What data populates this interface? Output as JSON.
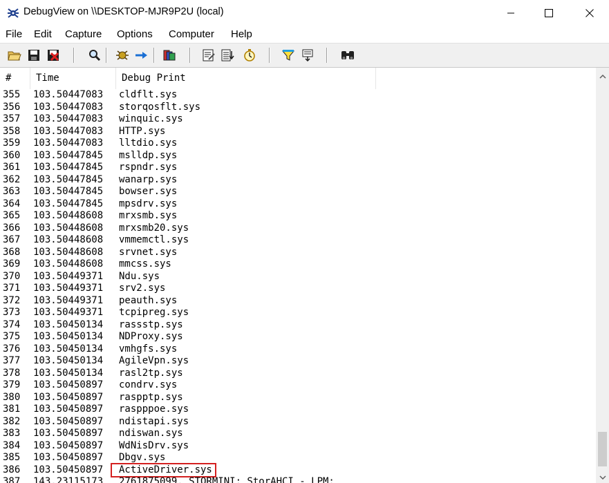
{
  "window": {
    "title": "DebugView on \\\\DESKTOP-MJR9P2U (local)"
  },
  "menu": {
    "items": [
      "File",
      "Edit",
      "Capture",
      "Options",
      "Computer",
      "Help"
    ]
  },
  "toolbar": {
    "icons": [
      "open-icon",
      "save-icon",
      "clear-display-icon",
      "find-icon",
      "capture-icon",
      "autoscroll-icon",
      "history-depth-icon",
      "filter-icon",
      "append-icon",
      "clock-time-icon",
      "highlight-icon",
      "log-icon",
      "binoculars-icon"
    ]
  },
  "columns": {
    "num": "#",
    "time": "Time",
    "msg": "Debug Print"
  },
  "rows": [
    {
      "num": "355",
      "time": "103.50447083",
      "msg": "cldflt.sys"
    },
    {
      "num": "356",
      "time": "103.50447083",
      "msg": "storqosflt.sys"
    },
    {
      "num": "357",
      "time": "103.50447083",
      "msg": "winquic.sys"
    },
    {
      "num": "358",
      "time": "103.50447083",
      "msg": "HTTP.sys"
    },
    {
      "num": "359",
      "time": "103.50447083",
      "msg": "lltdio.sys"
    },
    {
      "num": "360",
      "time": "103.50447845",
      "msg": "mslldp.sys"
    },
    {
      "num": "361",
      "time": "103.50447845",
      "msg": "rspndr.sys"
    },
    {
      "num": "362",
      "time": "103.50447845",
      "msg": "wanarp.sys"
    },
    {
      "num": "363",
      "time": "103.50447845",
      "msg": "bowser.sys"
    },
    {
      "num": "364",
      "time": "103.50447845",
      "msg": "mpsdrv.sys"
    },
    {
      "num": "365",
      "time": "103.50448608",
      "msg": "mrxsmb.sys"
    },
    {
      "num": "366",
      "time": "103.50448608",
      "msg": "mrxsmb20.sys"
    },
    {
      "num": "367",
      "time": "103.50448608",
      "msg": "vmmemctl.sys"
    },
    {
      "num": "368",
      "time": "103.50448608",
      "msg": "srvnet.sys"
    },
    {
      "num": "369",
      "time": "103.50448608",
      "msg": "mmcss.sys"
    },
    {
      "num": "370",
      "time": "103.50449371",
      "msg": "Ndu.sys"
    },
    {
      "num": "371",
      "time": "103.50449371",
      "msg": "srv2.sys"
    },
    {
      "num": "372",
      "time": "103.50449371",
      "msg": "peauth.sys"
    },
    {
      "num": "373",
      "time": "103.50449371",
      "msg": "tcpipreg.sys"
    },
    {
      "num": "374",
      "time": "103.50450134",
      "msg": "rassstp.sys"
    },
    {
      "num": "375",
      "time": "103.50450134",
      "msg": "NDProxy.sys"
    },
    {
      "num": "376",
      "time": "103.50450134",
      "msg": "vmhgfs.sys"
    },
    {
      "num": "377",
      "time": "103.50450134",
      "msg": "AgileVpn.sys"
    },
    {
      "num": "378",
      "time": "103.50450134",
      "msg": "rasl2tp.sys"
    },
    {
      "num": "379",
      "time": "103.50450897",
      "msg": "condrv.sys"
    },
    {
      "num": "380",
      "time": "103.50450897",
      "msg": "raspptp.sys"
    },
    {
      "num": "381",
      "time": "103.50450897",
      "msg": "raspppoe.sys"
    },
    {
      "num": "382",
      "time": "103.50450897",
      "msg": "ndistapi.sys"
    },
    {
      "num": "383",
      "time": "103.50450897",
      "msg": "ndiswan.sys"
    },
    {
      "num": "384",
      "time": "103.50450897",
      "msg": "WdNisDrv.sys"
    },
    {
      "num": "385",
      "time": "103.50450897",
      "msg": "Dbgv.sys"
    },
    {
      "num": "386",
      "time": "103.50450897",
      "msg": "ActiveDriver.sys",
      "highlighted": true
    },
    {
      "num": "387",
      "time": "143.23115173",
      "msg": "2761875099. STORMINI: StorAHCI - LPM:"
    }
  ],
  "colors": {
    "highlight_box": "#d42020",
    "toolbar_bg": "#f0f0f0"
  }
}
